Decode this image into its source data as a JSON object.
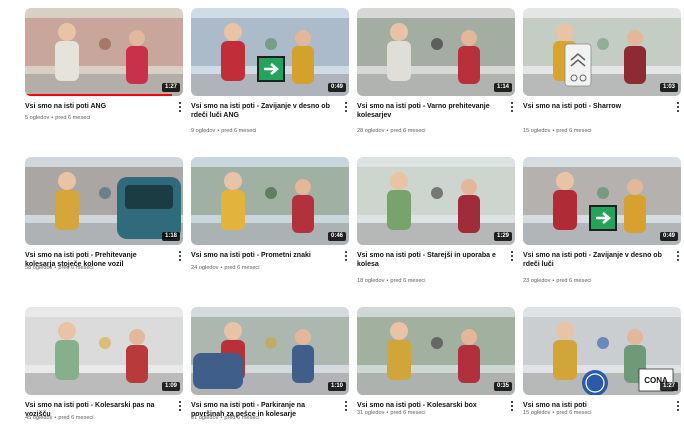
{
  "videos": [
    {
      "title": "Vsi smo na isti poti ANG",
      "views": "5 ogledov",
      "age": "pred 6 meseci",
      "duration": "1:27",
      "watched": 0.93,
      "thumb_icon": "two-cyclists-helmets"
    },
    {
      "title": "Vsi smo na isti poti - Zavijanje v desno ob rdeči luči ANG",
      "views": "9 ogledov",
      "age": "pred 6 meseci",
      "duration": "0:49",
      "watched": 0,
      "thumb_icon": "green-right-arrow-sign"
    },
    {
      "title": "Vsi smo na isti poti - Varno prehitevanje kolesarjev",
      "views": "28 ogledov",
      "age": "pred 6 meseci",
      "duration": "1:14",
      "watched": 0,
      "thumb_icon": "driver-and-cyclist"
    },
    {
      "title": "Vsi smo na isti poti - Sharrow",
      "views": "15 ogledov",
      "age": "pred 6 meseci",
      "duration": "1:03",
      "watched": 0,
      "thumb_icon": "sharrow-sign"
    },
    {
      "title": "Vsi smo na isti poti - Prehitevanje kolesarja stoječe kolone vozil",
      "views": "58 ogledov",
      "age": "pred 6 meseci",
      "duration": "1:18",
      "watched": 0,
      "thumb_icon": "cyclist-by-car"
    },
    {
      "title": "Vsi smo na isti poti - Prometni znaki",
      "views": "24 ogledov",
      "age": "pred 6 meseci",
      "duration": "0:46",
      "watched": 0,
      "thumb_icon": "man-and-cyclist"
    },
    {
      "title": "Vsi smo na isti poti - Starejši in uporaba e kolesa",
      "views": "18 ogledov",
      "age": "pred 6 meseci",
      "duration": "1:29",
      "watched": 0,
      "thumb_icon": "e-bike-rider"
    },
    {
      "title": "Vsi smo na isti poti - Zavijanje v desno ob rdeči luči",
      "views": "23 ogledov",
      "age": "pred 6 meseci",
      "duration": "0:49",
      "watched": 0,
      "thumb_icon": "green-right-arrow-sign"
    },
    {
      "title": "Vsi smo na isti poti - Kolesarski pas na vozišču",
      "views": "45 ogledov",
      "age": "pred 6 meseci",
      "duration": "1:09",
      "watched": 0,
      "thumb_icon": "cyclists-in-studio"
    },
    {
      "title": "Vsi smo na isti poti - Parkiranje na površinah za pešce in kolesarje",
      "views": "31 ogledov",
      "age": "pred 6 meseci",
      "duration": "1:10",
      "watched": 0,
      "thumb_icon": "parked-car-scene"
    },
    {
      "title": "Vsi smo na isti poti - Kolesarski box",
      "views": "31 ogledov",
      "age": "pred 6 meseci",
      "duration": "0:35",
      "watched": 0,
      "thumb_icon": "cyclist-at-box"
    },
    {
      "title": "Vsi smo na isti poti",
      "views": "15 ogledov",
      "age": "pred 6 meseci",
      "duration": "1:27",
      "watched": 0,
      "thumb_icon": "cyclist-road-sign",
      "thumb_sign_text": "CONA"
    }
  ],
  "meta_separator": "•",
  "colors": {
    "accent": "#ff0000",
    "meta_text": "#606060",
    "title_text": "#0f0f0f"
  }
}
